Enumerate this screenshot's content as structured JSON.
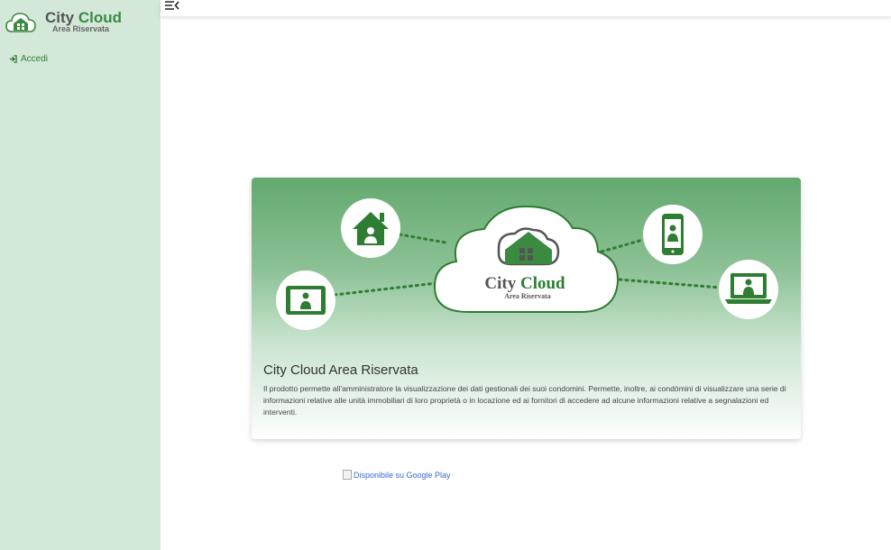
{
  "sidebar": {
    "logo": {
      "title_part1": "City",
      "title_part2": "Cloud",
      "subtitle": "Area Riservata"
    },
    "items": [
      {
        "label": "Accedi",
        "icon": "sign-in-icon"
      }
    ]
  },
  "topbar": {
    "menu_icon": "menu-collapse-icon"
  },
  "hero": {
    "cloud_title_part1": "City",
    "cloud_title_part2": "Cloud",
    "cloud_subtitle": "Area Riservata",
    "icons": [
      "house-user-icon",
      "tablet-user-icon",
      "phone-user-icon",
      "laptop-user-icon"
    ]
  },
  "card": {
    "title": "City Cloud Area Riservata",
    "description": "Il prodotto permette all'amministratore la visualizzazione dei dati gestionali dei suoi condomini. Permette, inoltre, ai condòmini di visualizzare una serie di informazioni relative alle unità immobiliari di loro proprietà o in locazione ed ai fornitori di accedere ad alcune informazioni relative a segnalazioni ed interventi."
  },
  "store_link": {
    "alt_text": "Disponibile su Google Play"
  },
  "colors": {
    "brand_green": "#3a8a3f",
    "sidebar_bg": "#d4e8d9",
    "link_blue": "#3b6bc9"
  }
}
